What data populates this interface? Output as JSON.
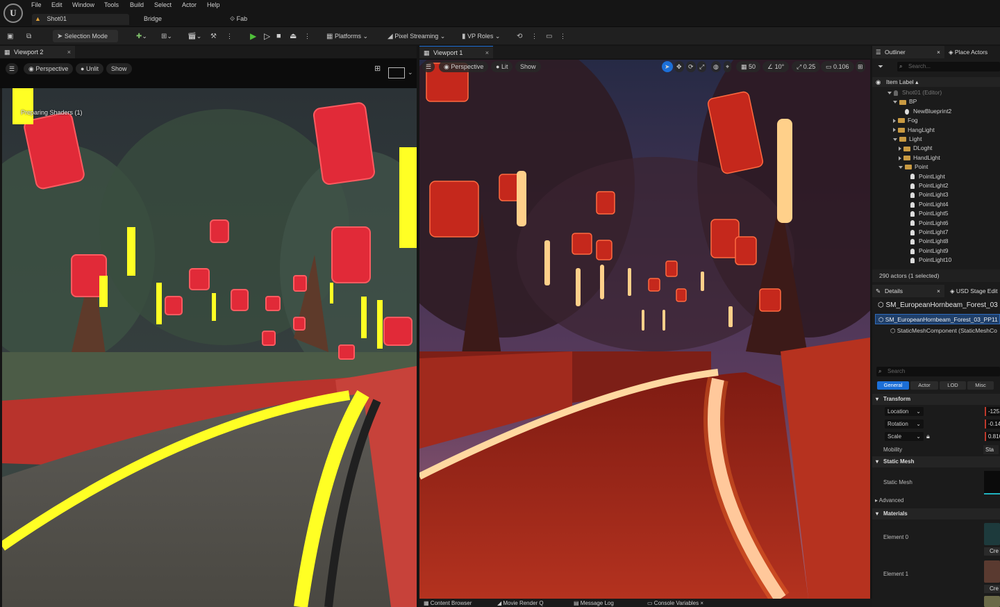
{
  "menu": {
    "items": [
      "File",
      "Edit",
      "Window",
      "Tools",
      "Build",
      "Select",
      "Actor",
      "Help"
    ]
  },
  "doc_tabs": {
    "level": "Shot01",
    "bridge": "Bridge",
    "fab": "Fab"
  },
  "toolbar": {
    "selection_mode": "Selection Mode",
    "platforms": "Platforms",
    "pixel_streaming": "Pixel Streaming",
    "vp_roles": "VP Roles"
  },
  "viewport2": {
    "tab": "Viewport 2",
    "perspective": "Perspective",
    "view_mode": "Unlit",
    "show": "Show",
    "overlay": "Preparing Shaders (1)"
  },
  "viewport1": {
    "tab": "Viewport 1",
    "perspective": "Perspective",
    "view_mode": "Lit",
    "show": "Show",
    "grid_snap": "50",
    "rot_snap": "10°",
    "scale_snap": "0.25",
    "camera_speed": "0.106"
  },
  "outliner": {
    "tab": "Outliner",
    "place_actors": "Place Actors",
    "search_placeholder": "Search...",
    "column": "Item Label",
    "rows": [
      {
        "label": "Shot01 (Editor)",
        "indent": 0,
        "kind": "level",
        "arrow": "down"
      },
      {
        "label": "BP",
        "indent": 1,
        "kind": "folder",
        "arrow": "down"
      },
      {
        "label": "NewBlueprint2",
        "indent": 2,
        "kind": "actor",
        "arrow": ""
      },
      {
        "label": "Fog",
        "indent": 1,
        "kind": "folder",
        "arrow": "right"
      },
      {
        "label": "HangLight",
        "indent": 1,
        "kind": "folder",
        "arrow": "right"
      },
      {
        "label": "Light",
        "indent": 1,
        "kind": "folder",
        "arrow": "down"
      },
      {
        "label": "DLoght",
        "indent": 2,
        "kind": "folder",
        "arrow": "right"
      },
      {
        "label": "HandLight",
        "indent": 2,
        "kind": "folder",
        "arrow": "right"
      },
      {
        "label": "Point",
        "indent": 2,
        "kind": "folder",
        "arrow": "down"
      },
      {
        "label": "PointLight",
        "indent": 3,
        "kind": "light",
        "arrow": ""
      },
      {
        "label": "PointLight2",
        "indent": 3,
        "kind": "light",
        "arrow": ""
      },
      {
        "label": "PointLight3",
        "indent": 3,
        "kind": "light",
        "arrow": ""
      },
      {
        "label": "PointLight4",
        "indent": 3,
        "kind": "light",
        "arrow": ""
      },
      {
        "label": "PointLight5",
        "indent": 3,
        "kind": "light",
        "arrow": ""
      },
      {
        "label": "PointLight6",
        "indent": 3,
        "kind": "light",
        "arrow": ""
      },
      {
        "label": "PointLight7",
        "indent": 3,
        "kind": "light",
        "arrow": ""
      },
      {
        "label": "PointLight8",
        "indent": 3,
        "kind": "light",
        "arrow": ""
      },
      {
        "label": "PointLight9",
        "indent": 3,
        "kind": "light",
        "arrow": ""
      },
      {
        "label": "PointLight10",
        "indent": 3,
        "kind": "light",
        "arrow": ""
      }
    ],
    "status": "290 actors (1 selected)"
  },
  "details": {
    "tab": "Details",
    "usd_tab": "USD Stage Edit",
    "actor_name": "SM_EuropeanHornbeam_Forest_03",
    "selected_component": "SM_EuropeanHornbeam_Forest_03_PP11",
    "sub_component": "StaticMeshComponent (StaticMeshCo",
    "search_placeholder": "Search",
    "filter_tabs": [
      "General",
      "Actor",
      "LOD",
      "Misc"
    ],
    "transform": {
      "title": "Transform",
      "location": "Location",
      "location_val": "-125.",
      "rotation": "Rotation",
      "rotation_val": "-0.14",
      "scale": "Scale",
      "scale_val": "0.816",
      "mobility": "Mobility",
      "mobility_val": "Sta"
    },
    "static_mesh": {
      "title": "Static Mesh",
      "label": "Static Mesh",
      "advanced": "Advanced"
    },
    "materials": {
      "title": "Materials",
      "element0": "Element 0",
      "element1": "Element 1",
      "create": "Cre"
    }
  },
  "bottom_tabs": [
    "Content Browser",
    "Movie Render Q",
    "Message Log",
    "Console Variables"
  ],
  "colors": {
    "accent": "#1c6fd8",
    "play": "#4fbf3a",
    "folder": "#c99a42"
  }
}
